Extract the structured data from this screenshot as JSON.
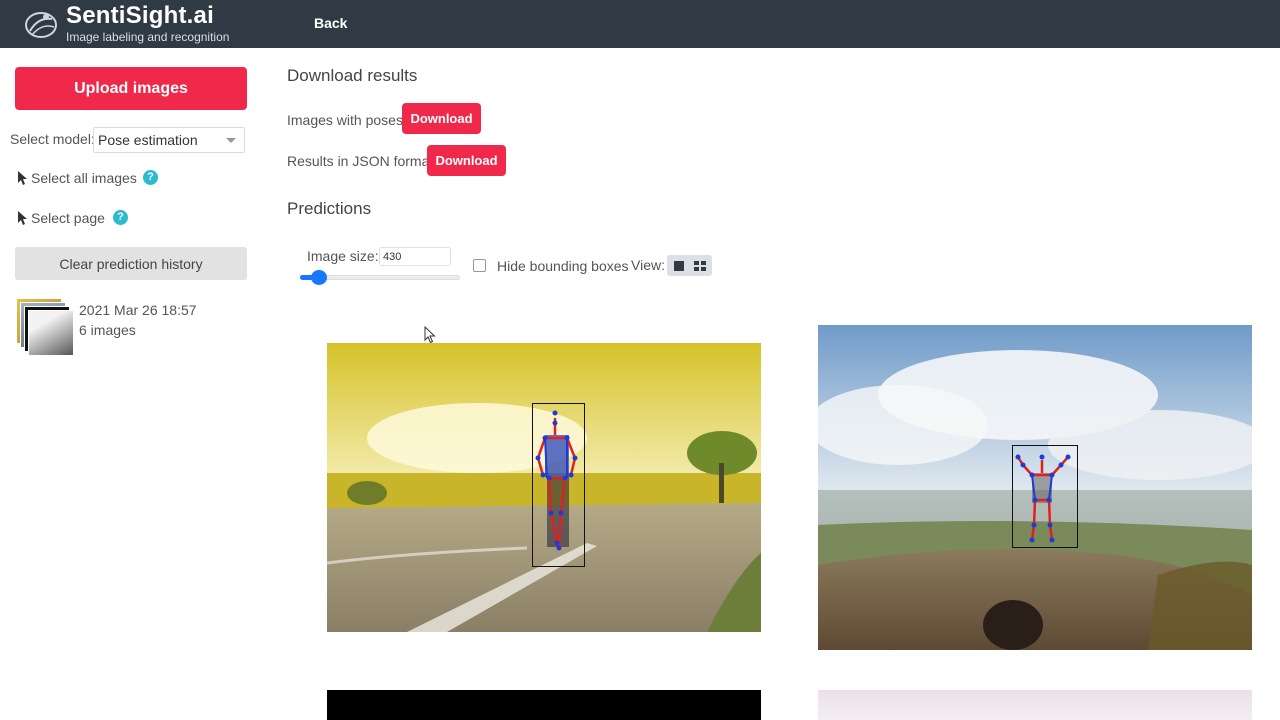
{
  "header": {
    "brand": "SentiSight.ai",
    "tagline": "Image labeling and recognition",
    "back_label": "Back"
  },
  "sidebar": {
    "upload_label": "Upload images",
    "model_label": "Select model:",
    "model_value": "Pose estimation",
    "select_all_label": "Select all images",
    "select_page_label": "Select page",
    "help_glyph": "?",
    "clear_label": "Clear prediction history",
    "history": {
      "date": "2021 Mar 26 18:57",
      "count": "6 images"
    }
  },
  "main": {
    "download_title": "Download results",
    "images_with_poses_label": "Images with poses:",
    "json_label": "Results in JSON format:",
    "download_label": "Download",
    "predictions_title": "Predictions",
    "image_size_label": "Image size:",
    "image_size_value": "430",
    "image_size_slider_fraction": 0.12,
    "hide_boxes_label": "Hide bounding boxes",
    "hide_boxes_checked": false,
    "view_label": "View:",
    "view_modes": [
      "single-view-icon",
      "grid-view-icon"
    ]
  },
  "colors": {
    "header_bg": "#2f3a45",
    "accent_red": "#f0284a",
    "help_teal": "#2bbbd0",
    "slider_blue": "#1677ff",
    "skeleton_red": "#e0201f",
    "skeleton_blue": "#1f3ad6"
  },
  "icons": [
    "logo-icon",
    "cursor-icon",
    "help-icon",
    "single-view-icon",
    "grid-view-icon",
    "mouse-pointer-icon"
  ]
}
